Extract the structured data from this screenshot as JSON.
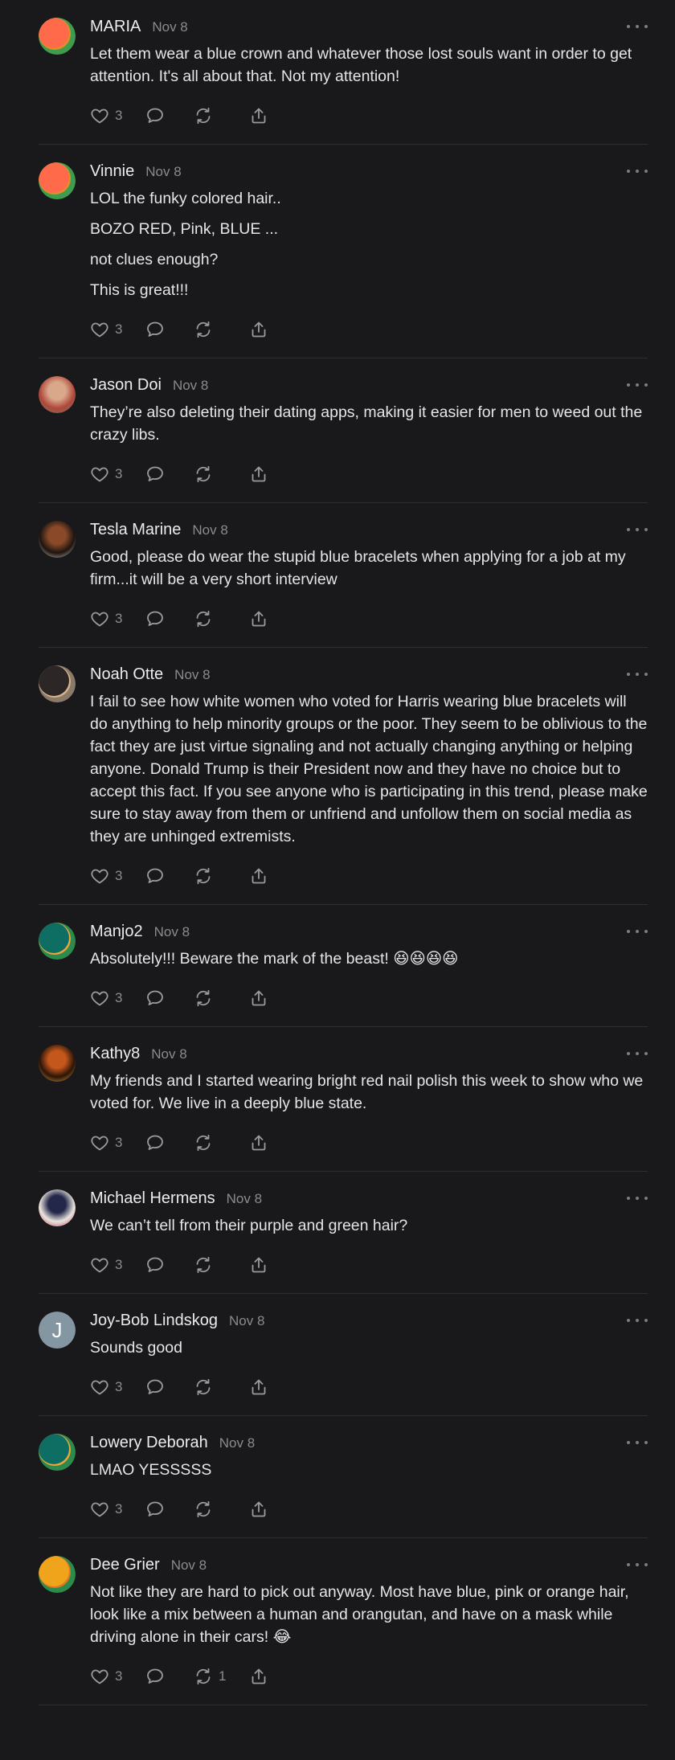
{
  "comments": [
    {
      "name": "MARIA",
      "date": "Nov 8",
      "avatar": {
        "kind": "disc",
        "colors": [
          "#ff6b4a",
          "#e0902a",
          "#3f9c4e"
        ]
      },
      "paragraphs": [
        "Let them wear a blue crown and whatever those lost souls want in order to get attention. It's all about that. Not my attention!"
      ],
      "likes": "3",
      "reposts": ""
    },
    {
      "name": "Vinnie",
      "date": "Nov 8",
      "avatar": {
        "kind": "disc",
        "colors": [
          "#ff6b4a",
          "#e0902a",
          "#3f9c4e"
        ]
      },
      "paragraphs": [
        "LOL the funky colored hair..",
        "BOZO RED, Pink, BLUE ...",
        "not clues enough?",
        "This is great!!!"
      ],
      "likes": "3",
      "reposts": ""
    },
    {
      "name": "Jason Doi",
      "date": "Nov 8",
      "avatar": {
        "kind": "photo",
        "colors": [
          "#b0473b",
          "#d9a88a",
          "#6b7a62"
        ]
      },
      "paragraphs": [
        "They’re also deleting their dating apps, making it easier for men to weed out the crazy libs."
      ],
      "likes": "3",
      "reposts": ""
    },
    {
      "name": "Tesla Marine",
      "date": "Nov 8",
      "avatar": {
        "kind": "photo",
        "colors": [
          "#1d1410",
          "#8a4a2a",
          "#d8cfc6"
        ]
      },
      "paragraphs": [
        "Good, please do wear the stupid blue bracelets when applying for a job at my firm...it will be a very short interview"
      ],
      "likes": "3",
      "reposts": ""
    },
    {
      "name": "Noah Otte",
      "date": "Nov 8",
      "avatar": {
        "kind": "disc",
        "colors": [
          "#2d2626",
          "#d8b48c",
          "#8a7a6a"
        ]
      },
      "paragraphs": [
        "I fail to see how white women who voted for Harris wearing blue bracelets will do anything to help minority groups or the poor. They seem to be oblivious to the fact they are just virtue signaling and not actually changing anything or helping anyone. Donald Trump is their President now and they have no choice but to accept this fact. If you see anyone who is participating in this trend, please make sure to stay away from them or unfriend and unfollow them on social media as they are unhinged extremists."
      ],
      "likes": "3",
      "reposts": ""
    },
    {
      "name": "Manjo2",
      "date": "Nov 8",
      "avatar": {
        "kind": "disc",
        "colors": [
          "#0f6e64",
          "#f0a63a",
          "#2c8a4d"
        ]
      },
      "paragraphs": [
        "Absolutely!!! Beware the mark of the beast! 😆😆😆😆"
      ],
      "likes": "3",
      "reposts": ""
    },
    {
      "name": "Kathy8",
      "date": "Nov 8",
      "avatar": {
        "kind": "photo",
        "colors": [
          "#2a1508",
          "#c4571c",
          "#f0a040"
        ]
      },
      "paragraphs": [
        "My friends and I started wearing bright red nail polish this week to show who we voted for. We live in a deeply blue state."
      ],
      "likes": "3",
      "reposts": ""
    },
    {
      "name": "Michael Hermens",
      "date": "Nov 8",
      "avatar": {
        "kind": "photo",
        "colors": [
          "#e9e4de",
          "#23284a",
          "#b23a52"
        ]
      },
      "paragraphs": [
        "We can’t tell from their purple and green hair?"
      ],
      "likes": "3",
      "reposts": ""
    },
    {
      "name": "Joy-Bob Lindskog",
      "date": "Nov 8",
      "avatar": {
        "kind": "letter",
        "letter": "J",
        "colors": [
          "#8496a2"
        ]
      },
      "paragraphs": [
        "Sounds good"
      ],
      "likes": "3",
      "reposts": ""
    },
    {
      "name": "Lowery Deborah",
      "date": "Nov 8",
      "avatar": {
        "kind": "disc",
        "colors": [
          "#0f6e64",
          "#f0a63a",
          "#2c8a4d"
        ]
      },
      "paragraphs": [
        "LMAO YESSSSS"
      ],
      "likes": "3",
      "reposts": ""
    },
    {
      "name": "Dee Grier",
      "date": "Nov 8",
      "avatar": {
        "kind": "disc",
        "colors": [
          "#f0a41c",
          "#e07a20",
          "#2c8a4d"
        ]
      },
      "paragraphs": [
        "Not like they are hard to pick out anyway. Most have blue, pink or orange hair, look like a mix between a human and orangutan, and have on a mask while driving alone in their cars! 😂"
      ],
      "likes": "3",
      "reposts": "1"
    }
  ],
  "icons": {
    "like": "heart-icon",
    "reply": "speech-bubble-icon",
    "repost": "repost-icon",
    "share": "share-icon",
    "more": "more-dots-icon"
  }
}
